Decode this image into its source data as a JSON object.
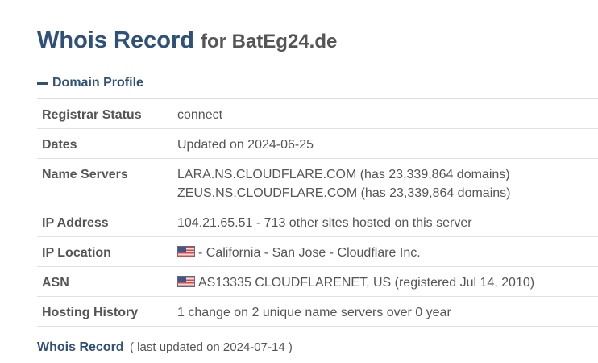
{
  "header": {
    "title_main": "Whois Record",
    "title_for": "for BatEg24.de"
  },
  "section": {
    "toggle_icon": "minus-icon",
    "label": "Domain Profile"
  },
  "profile": {
    "rows": [
      {
        "key": "Registrar Status",
        "value": "connect"
      },
      {
        "key": "Dates",
        "value": "Updated on 2024-06-25"
      },
      {
        "key": "Name Servers",
        "lines": [
          "LARA.NS.CLOUDFLARE.COM (has 23,339,864 domains)",
          "ZEUS.NS.CLOUDFLARE.COM (has 23,339,864 domains)"
        ]
      },
      {
        "key": "IP Address",
        "value": "104.21.65.51 - 713 other sites hosted on this server"
      },
      {
        "key": "IP Location",
        "flag_icon": "us-flag-icon",
        "value": "- California - San Jose - Cloudflare Inc."
      },
      {
        "key": "ASN",
        "flag_icon": "us-flag-icon",
        "value": "AS13335 CLOUDFLARENET, US (registered Jul 14, 2010)"
      },
      {
        "key": "Hosting History",
        "value": "1 change on 2 unique name servers over 0 year"
      }
    ]
  },
  "footer": {
    "link": "Whois Record",
    "meta": "( last updated on 2024-07-14 )"
  },
  "colors": {
    "title": "#2e5079",
    "text": "#555555",
    "rule": "#dddddd"
  }
}
